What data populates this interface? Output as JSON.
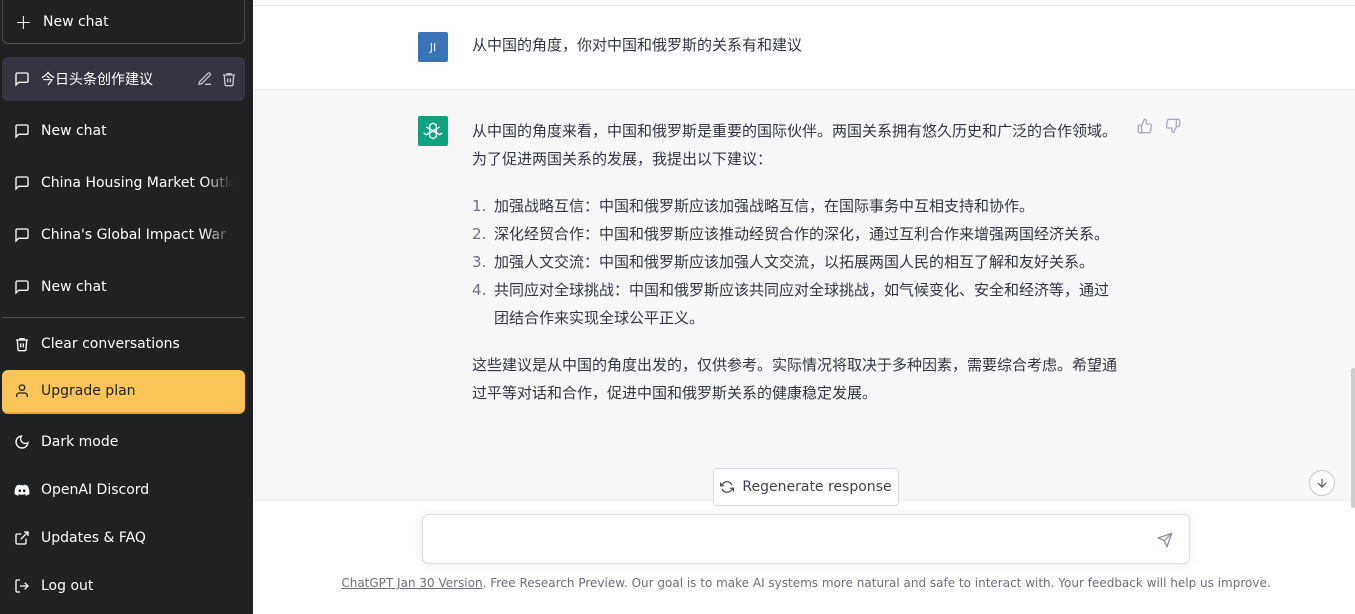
{
  "sidebar": {
    "new_chat_label": "New chat",
    "conversations": [
      {
        "label": "今日头条创作建议",
        "active": true
      },
      {
        "label": "New chat"
      },
      {
        "label": "China Housing Market Outlook"
      },
      {
        "label": "China's Global Impact War"
      },
      {
        "label": "New chat"
      }
    ],
    "menu": {
      "clear": "Clear conversations",
      "upgrade": "Upgrade plan",
      "dark_mode": "Dark mode",
      "discord": "OpenAI Discord",
      "faq": "Updates & FAQ",
      "logout": "Log out"
    }
  },
  "chat": {
    "user_initials": "JI",
    "user_message": "从中国的角度，你对中国和俄罗斯的关系有和建议",
    "assistant": {
      "intro": "从中国的角度来看，中国和俄罗斯是重要的国际伙伴。两国关系拥有悠久历史和广泛的合作领域。为了促进两国关系的发展，我提出以下建议：",
      "list": [
        {
          "num": "1.",
          "text": "加强战略互信：中国和俄罗斯应该加强战略互信，在国际事务中互相支持和协作。"
        },
        {
          "num": "2.",
          "text": "深化经贸合作：中国和俄罗斯应该推动经贸合作的深化，通过互利合作来增强两国经济关系。"
        },
        {
          "num": "3.",
          "text": "加强人文交流：中国和俄罗斯应该加强人文交流，以拓展两国人民的相互了解和友好关系。"
        },
        {
          "num": "4.",
          "text": "共同应对全球挑战：中国和俄罗斯应该共同应对全球挑战，如气候变化、安全和经济等，通过团结合作来实现全球公平正义。"
        }
      ],
      "outro": "这些建议是从中国的角度出发的，仅供参考。实际情况将取决于多种因素，需要综合考虑。希望通过平等对话和合作，促进中国和俄罗斯关系的健康稳定发展。"
    },
    "regenerate_label": "Regenerate response"
  },
  "input": {
    "placeholder": "",
    "value": ""
  },
  "footer": {
    "version_link": "ChatGPT Jan 30 Version",
    "text": ". Free Research Preview. Our goal is to make AI systems more natural and safe to interact with. Your feedback will help us improve."
  },
  "colors": {
    "sidebar_bg": "#202123",
    "accent_green": "#10a37f",
    "upgrade_yellow": "#fbc55a",
    "user_avatar": "#3a74b7"
  }
}
